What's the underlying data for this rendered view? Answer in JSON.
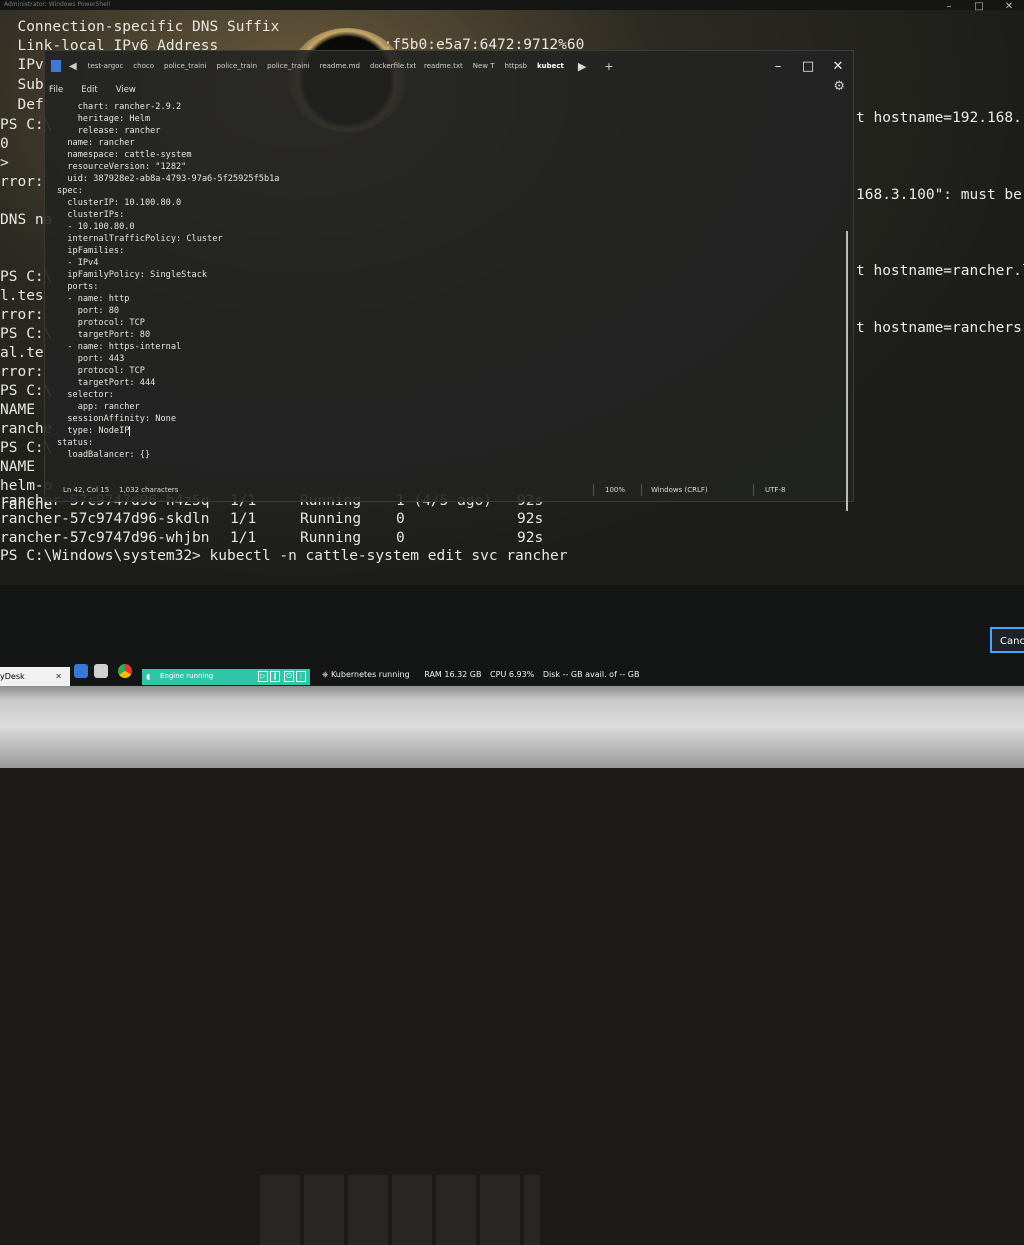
{
  "powershell": {
    "window_title": "Administrator: Windows PowerShell",
    "controls": {
      "minimize": "–",
      "maximize": "□",
      "close": "✕"
    },
    "left_lines": [
      "  Connection-specific DNS Suffix",
      "  Link-local IPv6 Address",
      "  IPv",
      "  Sub",
      "  Def",
      "PS C:\\",
      "0",
      ">",
      "rror:",
      "",
      "DNS na",
      "",
      "",
      "PS C:\\",
      "l.tes",
      "rror:",
      "PS C:\\",
      "al.te",
      "rror:",
      "PS C:\\",
      "NAME",
      "ranche",
      "PS C:\\",
      "NAME",
      "helm-o",
      "ranche"
    ],
    "ipv6_value": ". : fe80::f5b0:e5a7:6472:9712%60",
    "right_lines": [
      "t hostname=192.168.",
      "168.3.100\": must be",
      "t hostname=rancher.l",
      "t hostname=ranchers."
    ],
    "pod_rows": [
      {
        "name": "rancher-57c9747d96-h4z5q",
        "ready": "1/1",
        "status": "Running",
        "restarts": "1 (4/5 ago)",
        "age": "92s"
      },
      {
        "name": "rancher-57c9747d96-skdln",
        "ready": "1/1",
        "status": "Running",
        "restarts": "0",
        "age": "92s"
      },
      {
        "name": "rancher-57c9747d96-whjbn",
        "ready": "1/1",
        "status": "Running",
        "restarts": "0",
        "age": "92s"
      }
    ],
    "command_line": "PS C:\\Windows\\system32> kubectl -n cattle-system edit svc rancher"
  },
  "notepad": {
    "tabs": [
      "test-argoc",
      "choco",
      "police_traini",
      "police_train",
      "police_traini",
      "readme.md",
      "dockerfile.txt",
      "readme.txt",
      "New T",
      "httpsb",
      "kubect"
    ],
    "active_tab": 10,
    "tab_new": "+",
    "controls": {
      "minimize": "–",
      "maximize": "□",
      "close": "✕"
    },
    "menu": [
      "File",
      "Edit",
      "View"
    ],
    "content": [
      "    chart: rancher-2.9.2",
      "    heritage: Helm",
      "    release: rancher",
      "  name: rancher",
      "  namespace: cattle-system",
      "  resourceVersion: \"1282\"",
      "  uid: 387928e2-ab8a-4793-97a6-5f25925f5b1a",
      "spec:",
      "  clusterIP: 10.100.80.0",
      "  clusterIPs:",
      "  - 10.100.80.0",
      "  internalTrafficPolicy: Cluster",
      "  ipFamilies:",
      "  - IPv4",
      "  ipFamilyPolicy: SingleStack",
      "  ports:",
      "  - name: http",
      "    port: 80",
      "    protocol: TCP",
      "    targetPort: 80",
      "  - name: https-internal",
      "    port: 443",
      "    protocol: TCP",
      "    targetPort: 444",
      "  selector:",
      "    app: rancher",
      "  sessionAffinity: None",
      "  type: NodeIP",
      "status:",
      "  loadBalancer: {}"
    ],
    "status": {
      "position": "Ln 42, Col 15",
      "characters": "1,032 characters",
      "zoom": "100%",
      "line_endings": "Windows (CRLF)",
      "encoding": "UTF-8"
    }
  },
  "dialog": {
    "cancel_label": "Canc"
  },
  "taskbar": {
    "anydesk_label": "yDesk",
    "anydesk_close": "✕",
    "engine_label": "Engine running",
    "docker_status": [
      "Kubernetes running",
      "RAM 16.32 GB",
      "CPU 6.93%",
      "Disk -- GB avail. of -- GB"
    ]
  },
  "colors": {
    "engine_bar": "#2fc6a7",
    "cancel_border": "#4aa3ff"
  }
}
